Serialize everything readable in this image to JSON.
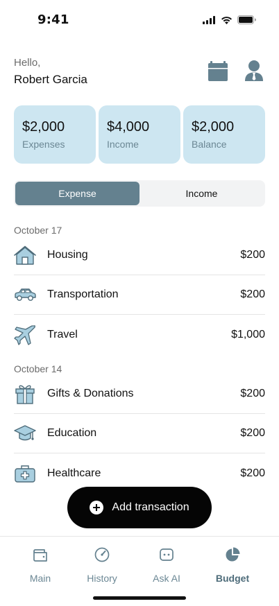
{
  "status": {
    "time": "9:41"
  },
  "header": {
    "greeting": "Hello,",
    "user_name": "Robert Garcia"
  },
  "summary": [
    {
      "amount": "$2,000",
      "label": "Expenses"
    },
    {
      "amount": "$4,000",
      "label": "Income"
    },
    {
      "amount": "$2,000",
      "label": "Balance"
    }
  ],
  "segments": {
    "expense": "Expense",
    "income": "Income",
    "selected": "Expense"
  },
  "groups": [
    {
      "date": "October 17",
      "items": [
        {
          "icon": "house-icon",
          "name": "Housing",
          "amount": "$200"
        },
        {
          "icon": "car-icon",
          "name": "Transportation",
          "amount": "$200"
        },
        {
          "icon": "airplane-icon",
          "name": "Travel",
          "amount": "$1,000"
        }
      ]
    },
    {
      "date": "October 14",
      "items": [
        {
          "icon": "gift-icon",
          "name": "Gifts & Donations",
          "amount": "$200"
        },
        {
          "icon": "graduation-cap-icon",
          "name": "Education",
          "amount": "$200"
        },
        {
          "icon": "medical-kit-icon",
          "name": "Healthcare",
          "amount": "$200"
        }
      ]
    }
  ],
  "add_button": {
    "label": "Add transaction"
  },
  "tabs": [
    {
      "label": "Main",
      "icon": "wallet-icon"
    },
    {
      "label": "History",
      "icon": "gauge-icon"
    },
    {
      "label": "Ask AI",
      "icon": "robot-icon"
    },
    {
      "label": "Budget",
      "icon": "pie-chart-icon",
      "active": true
    }
  ],
  "colors": {
    "accent": "#64818f",
    "card_bg": "#cde6f1",
    "icon_fill": "#a9cfe0",
    "icon_stroke": "#4e6c7a"
  }
}
